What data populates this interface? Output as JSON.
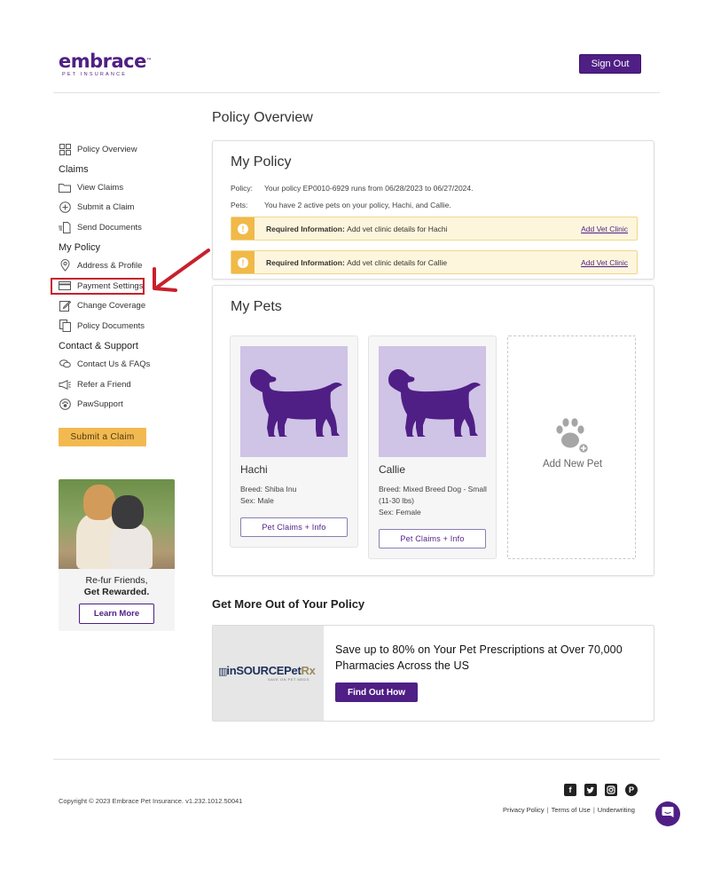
{
  "brand": {
    "name": "embrace",
    "tm": "™",
    "tagline": "PET INSURANCE"
  },
  "header": {
    "signout_label": "Sign Out"
  },
  "sidebar": {
    "overview": "Policy Overview",
    "claims_heading": "Claims",
    "claims_items": [
      "View Claims",
      "Submit a Claim",
      "Send Documents"
    ],
    "policy_heading": "My Policy",
    "policy_items": [
      "Address & Profile",
      "Payment Settings",
      "Change Coverage",
      "Policy Documents"
    ],
    "support_heading": "Contact & Support",
    "support_items": [
      "Contact Us & FAQs",
      "Refer a Friend",
      "PawSupport"
    ],
    "submit_button": "Submit a Claim",
    "promo": {
      "line1": "Re-fur Friends,",
      "line2": "Get Rewarded.",
      "button": "Learn More"
    }
  },
  "main": {
    "page_title": "Policy Overview",
    "my_policy": {
      "title": "My Policy",
      "policy_label": "Policy:",
      "policy_text": "Your policy EP0010-6929 runs from 06/28/2023 to 06/27/2024.",
      "pets_label": "Pets:",
      "pets_text": "You have 2 active pets on your policy, Hachi, and Callie.",
      "alerts": [
        {
          "bold": "Required Information:",
          "text": "Add vet clinic details for Hachi",
          "link": "Add Vet Clinic"
        },
        {
          "bold": "Required Information:",
          "text": "Add vet clinic details for Callie",
          "link": "Add Vet Clinic"
        }
      ]
    },
    "my_pets": {
      "title": "My Pets",
      "pets": [
        {
          "name": "Hachi",
          "breed": "Breed:  Shiba Inu",
          "sex": "Sex:  Male",
          "button": "Pet Claims + Info"
        },
        {
          "name": "Callie",
          "breed": "Breed:  Mixed Breed Dog - Small (11-30 lbs)",
          "sex": "Sex:  Female",
          "button": "Pet Claims + Info"
        }
      ],
      "add_new": "Add New Pet"
    },
    "more": {
      "heading": "Get More Out of Your Policy",
      "ad_logo": "inSOURCEPet",
      "ad_logo_rx": "Rx",
      "ad_logo_sub": "SAVE ON PET MEDS",
      "ad_text": "Save up to 80% on Your Pet Prescriptions at Over 70,000 Pharmacies Across the US",
      "ad_button": "Find Out How"
    }
  },
  "footer": {
    "copyright": "Copyright © 2023   Embrace Pet Insurance. v1.232.1012.50041",
    "links": [
      "Privacy Policy",
      "Terms of Use",
      "Underwriting"
    ],
    "social": [
      "facebook-icon",
      "twitter-icon",
      "instagram-icon",
      "pinterest-icon"
    ]
  },
  "colors": {
    "brand": "#4f1f85",
    "accent": "#f3b951",
    "alert_bg": "#fdf6dc",
    "highlight": "#c8202c"
  }
}
